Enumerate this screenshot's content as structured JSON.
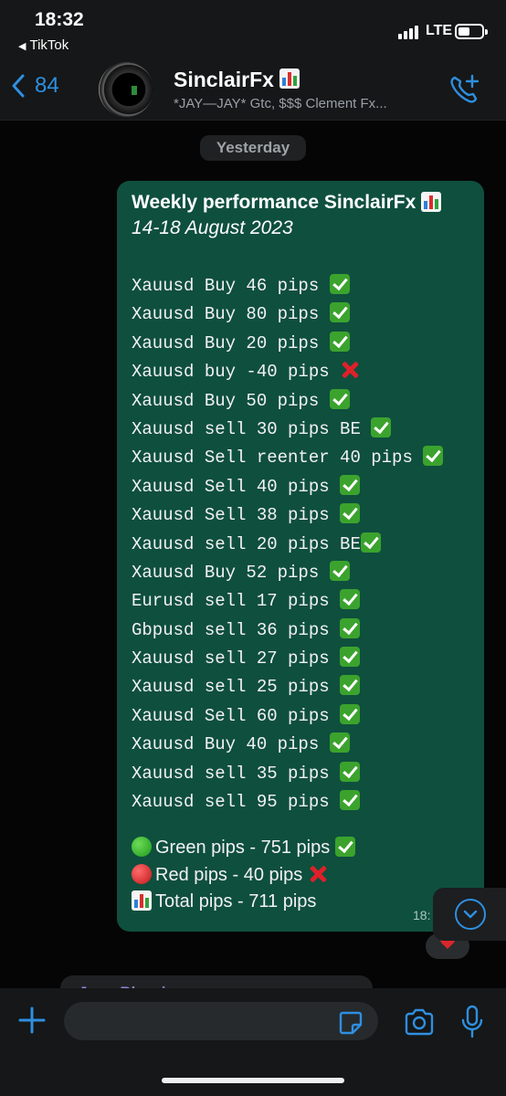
{
  "status_bar": {
    "time": "18:32",
    "back_app": "TikTok",
    "network": "LTE"
  },
  "header": {
    "back_count": "84",
    "chat_name": "SinclairFx",
    "chat_subtitle": "*JAY—JAY*  Gtc, $$$ Clement Fx..."
  },
  "chat": {
    "date_label": "Yesterday",
    "message": {
      "title": "Weekly performance SinclairFx",
      "subtitle": "14-18 August 2023",
      "lines": [
        {
          "text": "Xauusd Buy 46 pips ",
          "status": "check"
        },
        {
          "text": "Xauusd Buy 80 pips ",
          "status": "check"
        },
        {
          "text": "Xauusd Buy 20 pips ",
          "status": "check"
        },
        {
          "text": "Xauusd buy -40 pips ",
          "status": "cross"
        },
        {
          "text": "Xauusd Buy 50 pips ",
          "status": "check"
        },
        {
          "text": "Xauusd sell 30 pips BE ",
          "status": "check"
        },
        {
          "text": "Xauusd Sell reenter 40 pips ",
          "status": "check"
        },
        {
          "text": "Xauusd Sell 40 pips ",
          "status": "check"
        },
        {
          "text": "Xauusd Sell 38 pips ",
          "status": "check"
        },
        {
          "text": "Xauusd sell 20 pips BE",
          "status": "check"
        },
        {
          "text": "Xauusd Buy 52 pips ",
          "status": "check"
        },
        {
          "text": "Eurusd sell 17 pips ",
          "status": "check"
        },
        {
          "text": "Gbpusd sell 36 pips ",
          "status": "check"
        },
        {
          "text": "Xauusd sell 27 pips ",
          "status": "check"
        },
        {
          "text": "Xauusd sell 25 pips ",
          "status": "check"
        },
        {
          "text": "Xauusd Sell 60 pips ",
          "status": "check"
        },
        {
          "text": "Xauusd Buy 40 pips ",
          "status": "check"
        },
        {
          "text": "Xauusd sell 35 pips ",
          "status": "check"
        },
        {
          "text": "Xauusd sell 95 pips ",
          "status": "check"
        }
      ],
      "summary": {
        "green": "Green pips - 751 pips ",
        "red": "Red pips - 40 pips ",
        "total": "Total pips - 711 pips"
      },
      "time": "18:"
    },
    "next_message_preview": "Juno Blessing"
  },
  "colors": {
    "bubble": "#0f4f3e",
    "accent": "#2f8fe0",
    "check": "#3ba32d",
    "cross": "#e0202a"
  },
  "icons": [
    "back-chevron-icon",
    "add-call-icon",
    "scroll-down-icon",
    "plus-icon",
    "sticker-icon",
    "camera-icon",
    "mic-icon"
  ]
}
